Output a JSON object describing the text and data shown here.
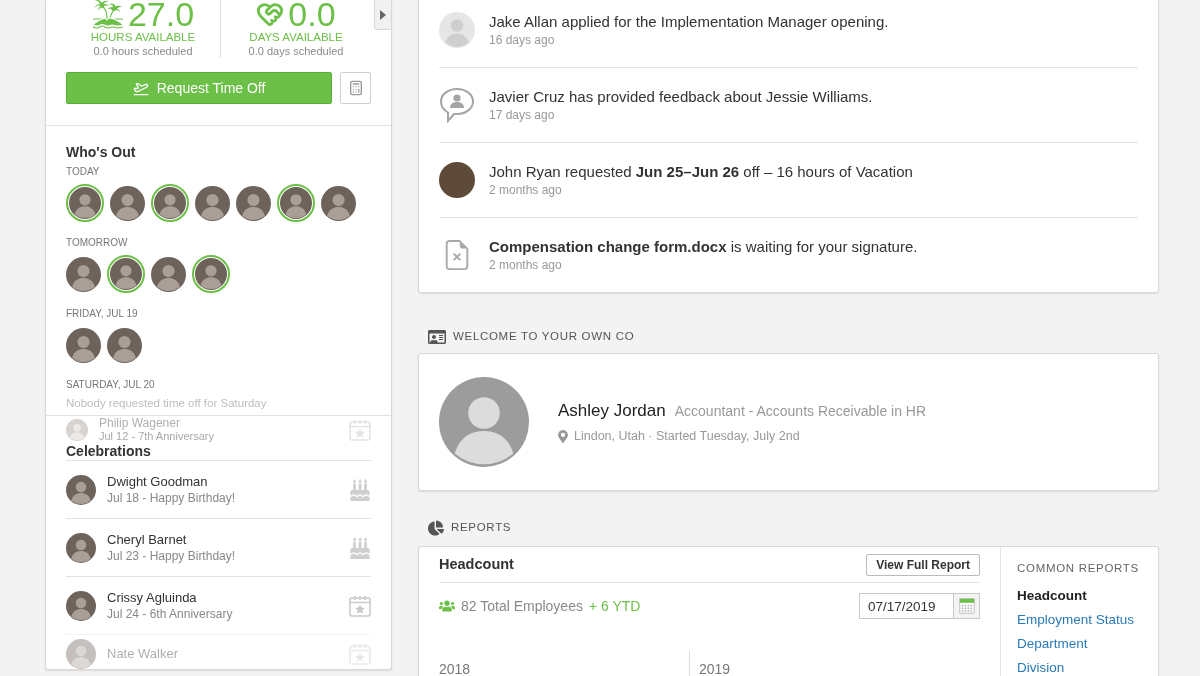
{
  "time_off": {
    "balances": [
      {
        "kind": "hours",
        "value": "27.0",
        "label": "HOURS AVAILABLE",
        "scheduled": "0.0 hours scheduled"
      },
      {
        "kind": "days",
        "value": "0.0",
        "label": "DAYS AVAILABLE",
        "scheduled": "0.0 days scheduled"
      }
    ],
    "request_button": "Request Time Off"
  },
  "whos_out": {
    "title": "Who's Out",
    "days": [
      {
        "label": "TODAY",
        "people": [
          {
            "highlighted": true
          },
          {
            "highlighted": false
          },
          {
            "highlighted": true
          },
          {
            "highlighted": false
          },
          {
            "highlighted": false
          },
          {
            "highlighted": true
          },
          {
            "highlighted": false
          }
        ]
      },
      {
        "label": "TOMORROW",
        "people": [
          {
            "highlighted": false
          },
          {
            "highlighted": true
          },
          {
            "highlighted": false
          },
          {
            "highlighted": true
          }
        ]
      },
      {
        "label": "FRIDAY, JUL 19",
        "people": [
          {
            "highlighted": false
          },
          {
            "highlighted": false
          }
        ]
      },
      {
        "label": "SATURDAY, JUL 20",
        "empty_message": "Nobody requested time off for Saturday"
      }
    ]
  },
  "celebrations": {
    "scrolled_item": {
      "kind": "anniversary",
      "name": "Philip Wagener",
      "detail": "Jul 12 - 7th Anniversary"
    },
    "title": "Celebrations",
    "items": [
      {
        "kind": "birthday",
        "name": "Dwight Goodman",
        "detail": "Jul 18 - Happy Birthday!",
        "faded": false
      },
      {
        "kind": "birthday",
        "name": "Cheryl Barnet",
        "detail": "Jul 23 - Happy Birthday!",
        "faded": false
      },
      {
        "kind": "anniversary",
        "name": "Crissy Agluinda",
        "detail": "Jul 24 - 6th Anniversary",
        "faded": false
      },
      {
        "kind": "anniversary",
        "name": "Nate Walker",
        "faded": true
      }
    ]
  },
  "activity": {
    "items": [
      {
        "kind": "applicant",
        "text": "Jake Allan applied for the Implementation Manager opening.",
        "time": "16 days ago"
      },
      {
        "kind": "feedback",
        "text": "Javier Cruz has provided feedback about Jessie Williams.",
        "time": "17 days ago"
      },
      {
        "kind": "time_off",
        "text": "John Ryan requested **Jun 25–Jun 26** off – 16 hours of Vacation",
        "time": "2 months ago"
      },
      {
        "kind": "document",
        "text": "**Compensation change form.docx** is waiting for your signature.",
        "time": "2 months ago"
      }
    ]
  },
  "welcome": {
    "title": "WELCOME TO YOUR OWN CO",
    "name": "Ashley Jordan",
    "job": "Accountant - Accounts Receivable in HR",
    "meta": "Lindon, Utah · Started Tuesday, July 2nd"
  },
  "reports": {
    "title": "REPORTS",
    "headcount": {
      "title": "Headcount",
      "button": "View Full Report",
      "total": "82 Total Employees",
      "change": "+ 6 YTD",
      "date": "07/17/2019",
      "periods": [
        "2018",
        "2019"
      ]
    },
    "common": {
      "title": "COMMON REPORTS",
      "items": [
        {
          "label": "Headcount",
          "selected": true
        },
        {
          "label": "Employment Status",
          "selected": false
        },
        {
          "label": "Department",
          "selected": false
        },
        {
          "label": "Division",
          "selected": false
        }
      ]
    }
  }
}
